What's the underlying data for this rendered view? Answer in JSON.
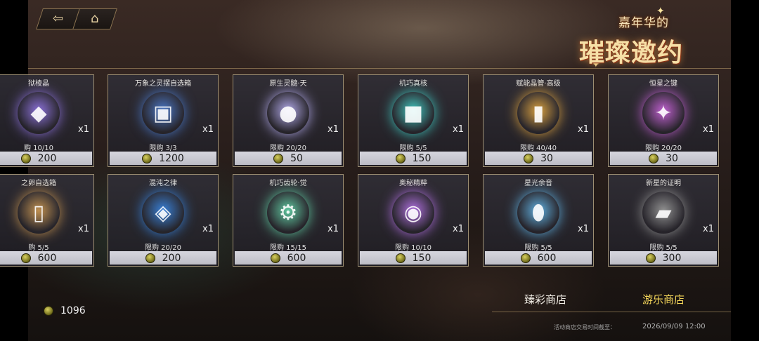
{
  "nav": {
    "back_icon": "back-arrow-icon",
    "home_icon": "home-icon"
  },
  "logo": {
    "subtitle": "嘉年华的",
    "title": "璀璨邀约"
  },
  "items": [
    {
      "name": "狱棱晶",
      "qty": "x1",
      "limit": "购 10/10",
      "price": "200",
      "icon": "crystal-icon",
      "color": "#8a70d8"
    },
    {
      "name": "万象之灵摆自选箱",
      "qty": "x1",
      "limit": "限购 3/3",
      "price": "1200",
      "icon": "treasure-chest-icon",
      "color": "#4a78c8"
    },
    {
      "name": "原生灵髓·天",
      "qty": "x1",
      "limit": "限购 20/20",
      "price": "50",
      "icon": "orb-icon",
      "color": "#b0a8e8"
    },
    {
      "name": "机巧真核",
      "qty": "x1",
      "limit": "限购 5/5",
      "price": "150",
      "icon": "cube-core-icon",
      "color": "#40c8c0"
    },
    {
      "name": "赋能晶管·高级",
      "qty": "x1",
      "limit": "限购 40/40",
      "price": "30",
      "icon": "crystal-tube-icon",
      "color": "#d8a040"
    },
    {
      "name": "恒星之键",
      "qty": "x1",
      "limit": "限购 20/20",
      "price": "30",
      "icon": "star-key-icon",
      "color": "#c060d0"
    },
    {
      "name": "之卵自选箱",
      "qty": "x1",
      "limit": "购 5/5",
      "price": "600",
      "icon": "egg-card-icon",
      "color": "#c09050"
    },
    {
      "name": "混沌之律",
      "qty": "x1",
      "limit": "限购 20/20",
      "price": "200",
      "icon": "chaos-cube-icon",
      "color": "#3880d8"
    },
    {
      "name": "机巧齿轮·觉",
      "qty": "x1",
      "limit": "限购 15/15",
      "price": "600",
      "icon": "gear-icon",
      "color": "#60c8a0"
    },
    {
      "name": "奥秘精粹",
      "qty": "x1",
      "limit": "限购 10/10",
      "price": "150",
      "icon": "arcane-essence-icon",
      "color": "#b070e0"
    },
    {
      "name": "星光余音",
      "qty": "x1",
      "limit": "限购 5/5",
      "price": "600",
      "icon": "star-jar-icon",
      "color": "#60b0e0"
    },
    {
      "name": "新星的证明",
      "qty": "x1",
      "limit": "限购 5/5",
      "price": "300",
      "icon": "proof-plate-icon",
      "color": "#909090"
    }
  ],
  "balance": {
    "value": "1096",
    "icon": "coin-icon"
  },
  "tabs": {
    "shop1": "臻彩商店",
    "shop2": "游乐商店"
  },
  "footer": {
    "label": "活动商店交易时间截至：",
    "time": "2026/09/09 12:00"
  },
  "colors": {
    "active_tab": "#f4d65a",
    "card_border": "#9c8e72",
    "price_bar": "#d0d0d8"
  }
}
